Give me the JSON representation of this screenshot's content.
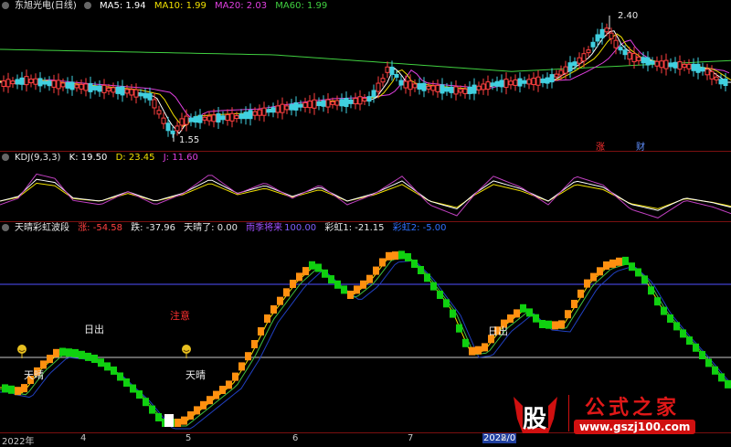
{
  "price": {
    "title": "东旭光电(日线)",
    "ma": [
      {
        "label": "MA5:",
        "value": "1.94",
        "color": "#ffffff"
      },
      {
        "label": "MA10:",
        "value": "1.99",
        "color": "#f0e000"
      },
      {
        "label": "MA20:",
        "value": "2.03",
        "color": "#e040e0"
      },
      {
        "label": "MA60:",
        "value": "1.99",
        "color": "#40d040"
      }
    ],
    "high_label": "2.40",
    "low_label": "1.55",
    "tag_zhang": "涨",
    "tag_cai": "财"
  },
  "kdj": {
    "title": "KDJ(9,3,3)",
    "k_label": "K:",
    "k_value": "19.50",
    "d_label": "D:",
    "d_value": "23.45",
    "j_label": "J:",
    "j_value": "11.60"
  },
  "rainbow": {
    "title": "天晴彩虹波段",
    "items": [
      {
        "text": "涨: -54.58",
        "color": "#ff4040"
      },
      {
        "text": "跌: -37.96",
        "color": "#e8e8e8"
      },
      {
        "text": "天晴了: 0.00",
        "color": "#e8e8e8"
      },
      {
        "text": "雨季将来",
        "color": "#a050ff"
      },
      {
        "text": "100.00",
        "color": "#8060ff"
      },
      {
        "text": "彩虹1: -21.15",
        "color": "#e8e8e8"
      },
      {
        "text": "彩虹2: -5.00",
        "color": "#3070ff"
      }
    ],
    "notes": {
      "zhuyi": "注意",
      "richu1": "日出",
      "richu2": "日出",
      "tianqing1": "天晴",
      "tianqing2": "天晴"
    }
  },
  "xaxis": {
    "labels": [
      "2022年",
      "4",
      "5",
      "6",
      "7",
      "2022/0",
      "8"
    ]
  },
  "watermark": {
    "logo": "股",
    "text": "公式之家",
    "url": "www.gszj100.com"
  }
}
